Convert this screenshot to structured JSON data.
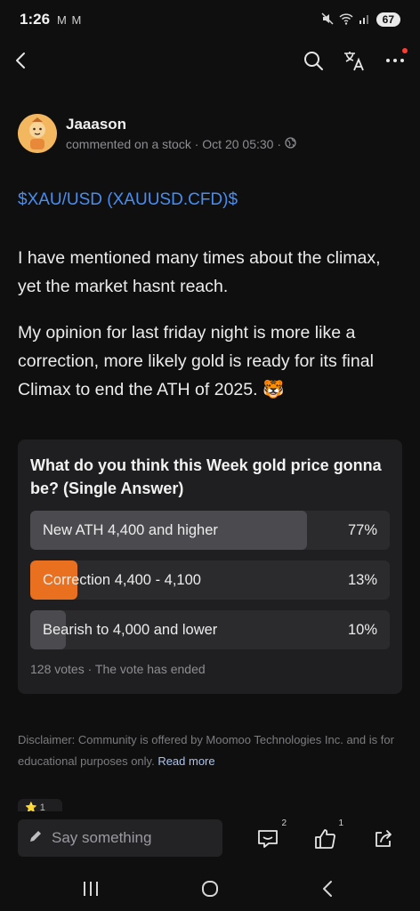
{
  "status": {
    "time": "1:26",
    "mail": "M M",
    "battery": "67"
  },
  "author": {
    "name": "Jaaason",
    "meta": "commented on a stock · Oct 20 05:30 ·"
  },
  "post": {
    "ticker": "$XAU/USD (XAUUSD.CFD)$",
    "paragraphs": [
      "I have mentioned many times about the climax, yet the market hasnt reach.",
      "My opinion for last friday night is more like a correction, more likely gold is ready for its final Climax to end the ATH of 2025. 🐯"
    ]
  },
  "poll": {
    "question": "What do you think this Week gold price gonna be? (Single Answer)",
    "options": [
      {
        "label": "New ATH 4,400 and higher",
        "pct": "77%",
        "value": 0.77,
        "color": "#4b4b4f"
      },
      {
        "label": "Correction 4,400 - 4,100",
        "pct": "13%",
        "value": 0.13,
        "color": "#e8701f"
      },
      {
        "label": "Bearish to 4,000 and lower",
        "pct": "10%",
        "value": 0.1,
        "color": "#4b4b4f"
      }
    ],
    "footer": "128 votes · The vote has ended"
  },
  "disclaimer": {
    "text": "Disclaimer: Community is offered by Moomoo Technologies Inc. and is for educational purposes only. ",
    "read_more": "Read more"
  },
  "reaction_peek": "⭐ 1",
  "bottom_bar": {
    "placeholder": "Say something",
    "comment_count": "2",
    "like_count": "1"
  },
  "icons": {
    "back": "back-icon",
    "search": "search-icon",
    "translate": "translate-icon",
    "more": "more-icon",
    "comment": "comment-icon",
    "like": "thumbs-up-icon",
    "share": "share-icon"
  }
}
